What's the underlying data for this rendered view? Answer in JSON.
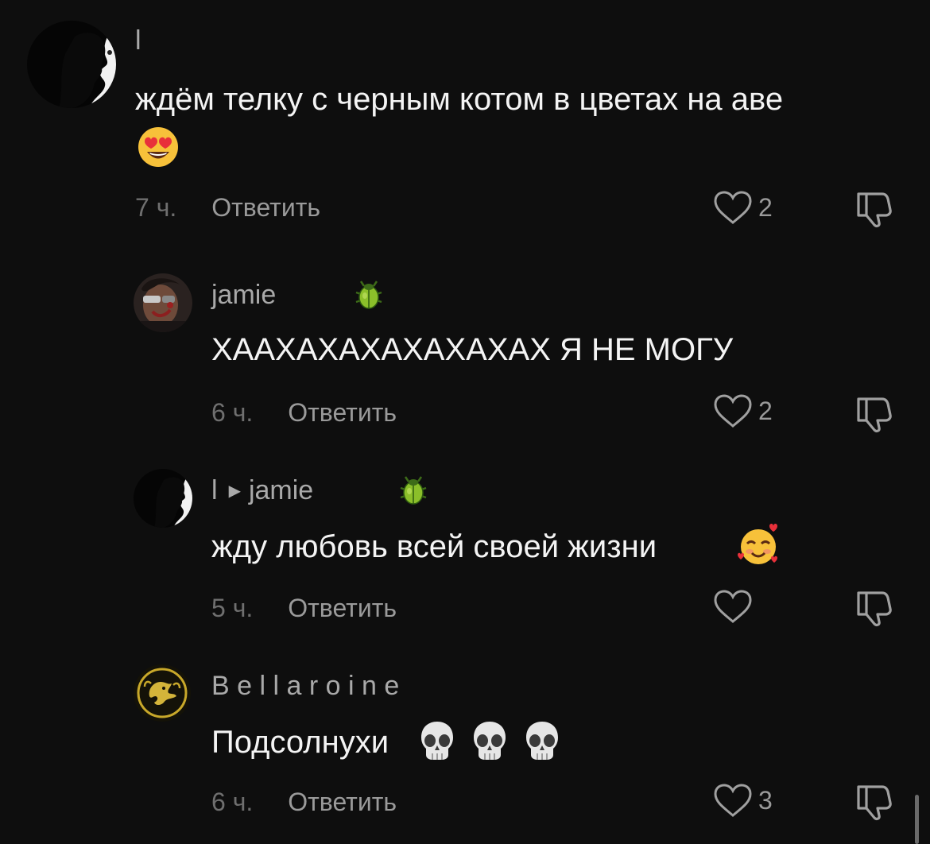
{
  "comments": [
    {
      "username": "l",
      "text": "ждём телку с черным котом в цветах на аве",
      "emoji": "heart-eyes",
      "time": "7 ч.",
      "reply_label": "Ответить",
      "likes": "2",
      "reply_to": ""
    },
    {
      "username": "jamie",
      "badge": "beetle",
      "text": "ХААХАХАХАХАХАХАХ Я НЕ МОГУ",
      "time": "6 ч.",
      "reply_label": "Ответить",
      "likes": "2"
    },
    {
      "username": "l",
      "reply_to": "jamie",
      "badge": "beetle",
      "text": "жду любовь всей своей жизни",
      "emoji": "smiling-face-with-hearts",
      "time": "5 ч.",
      "reply_label": "Ответить",
      "likes": ""
    },
    {
      "username": "B e l l a r o i n e",
      "text": "Подсолнухи",
      "emoji": "skull x3",
      "time": "6 ч.",
      "reply_label": "Ответить",
      "likes": "3"
    }
  ],
  "colors": {
    "background": "#0e0e0e",
    "text": "#f4f4f4",
    "secondary": "#9a9a9a"
  }
}
